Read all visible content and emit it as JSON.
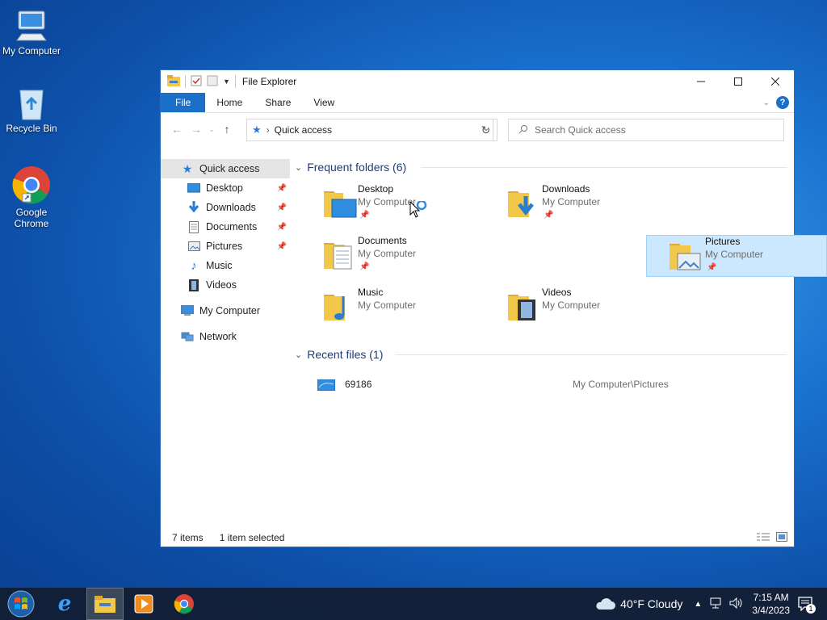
{
  "desktop": {
    "icons": [
      {
        "label": "My Computer"
      },
      {
        "label": "Recycle Bin"
      },
      {
        "label": "Google Chrome"
      }
    ]
  },
  "window": {
    "title": "File Explorer",
    "ribbon_tabs": {
      "file": "File",
      "home": "Home",
      "share": "Share",
      "view": "View"
    },
    "help_label": "?"
  },
  "address": {
    "crumb": "Quick access",
    "search_placeholder": "Search Quick access"
  },
  "nav": {
    "quick_access": "Quick access",
    "desktop": "Desktop",
    "downloads": "Downloads",
    "documents": "Documents",
    "pictures": "Pictures",
    "music": "Music",
    "videos": "Videos",
    "my_computer": "My Computer",
    "network": "Network"
  },
  "frequent": {
    "header": "Frequent folders (6)",
    "folders": [
      {
        "name": "Desktop",
        "location": "My Computer"
      },
      {
        "name": "Downloads",
        "location": "My Computer"
      },
      {
        "name": "Documents",
        "location": "My Computer"
      },
      {
        "name": "Pictures",
        "location": "My Computer"
      },
      {
        "name": "Music",
        "location": "My Computer"
      },
      {
        "name": "Videos",
        "location": "My Computer"
      }
    ]
  },
  "recent": {
    "header": "Recent files (1)",
    "files": [
      {
        "name": "69186",
        "location": "My Computer\\Pictures"
      }
    ]
  },
  "status": {
    "items": "7 items",
    "selected": "1 item selected"
  },
  "taskbar": {
    "weather": "40°F  Cloudy",
    "time": "7:15 AM",
    "date": "3/4/2023",
    "notification_count": "1"
  },
  "colors": {
    "accent": "#1a6fc9",
    "selection": "#cce8ff",
    "group_header": "#1e3c78"
  }
}
